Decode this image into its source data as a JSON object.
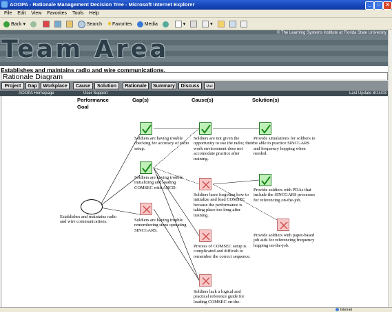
{
  "window": {
    "title": "AOOPA - Rationale Management Decision Tree - Microsoft Internet Explorer"
  },
  "menu": [
    "File",
    "Edit",
    "View",
    "Favorites",
    "Tools",
    "Help"
  ],
  "toolbar": {
    "back": "Back",
    "search": "Search",
    "favorites": "Favorites",
    "media": "Media"
  },
  "banner": {
    "copyright": "© The Learning Systems Institute at Florida State University",
    "title": "Team Area"
  },
  "page": {
    "subtitle": "Establishes and maintains radio and wire communications.",
    "diagram_title": "Rationale Diagram"
  },
  "nav": {
    "buttons": [
      "Project",
      "Gap",
      "Workplace",
      "Cause",
      "Solution",
      "Rationale",
      "Summary",
      "Discuss"
    ],
    "mini": "Mail"
  },
  "links": {
    "home": "AOOPA Homepage",
    "support": "User Support",
    "update": "Last Update 8/14/03"
  },
  "columns": {
    "goal": "Performance\nGoal",
    "gaps": "Gap(s)",
    "causes": "Cause(s)",
    "solutions": "Solution(s)"
  },
  "goal": {
    "text": "Establishes and maintains radio and wire communications."
  },
  "gaps": [
    {
      "status": "check",
      "text": "Soldiers are having trouble checking for accuracy of radio setup."
    },
    {
      "status": "check",
      "text": "Soldiers are having trouble initializing and loading COMSEC with ANCD."
    },
    {
      "status": "x",
      "text": "Soldiers are having trouble remembering steps operating SINCGARS."
    }
  ],
  "causes": [
    {
      "status": "check",
      "text": "Soldiers are not given the opportunity to use the radio; their work environment does not accomodate practice after training."
    },
    {
      "status": "x",
      "text": "Soldiers have forgotten how to initialize and load COMSEC because the performance is taking place too long after training."
    },
    {
      "status": "x",
      "text": "Process of COMSEC setup is complicated and difficult to remember the correct sequence."
    },
    {
      "status": "x",
      "text": "Soldiers lack a logical and practical reference guide for loading COMSEC on-the-"
    }
  ],
  "solutions": [
    {
      "status": "check",
      "text": "Provide simulations for soldiers to be able to practice SINCGARS and frequency hopping when needed."
    },
    {
      "status": "check",
      "text": "Provide soldiers with PDAs that include the SINCGARS processes for referencing on-the-job."
    },
    {
      "status": "x",
      "text": "Provide soldiers with paper-based job aids for referencing frequency hopping on-the-job."
    }
  ],
  "status": {
    "zone": "Internet"
  }
}
